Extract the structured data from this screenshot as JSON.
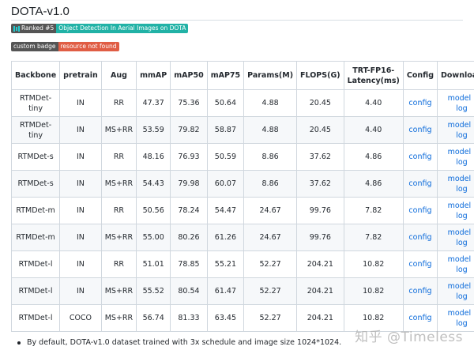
{
  "page": {
    "title": "DOTA-v1.0"
  },
  "badges": [
    {
      "left": "Ranked #5",
      "right": "Object Detection In Aerial Images on DOTA",
      "icon": "paperswithcode-icon"
    },
    {
      "left": "custom badge",
      "right": "resource not found"
    }
  ],
  "table": {
    "headers": [
      "Backbone",
      "pretrain",
      "Aug",
      "mmAP",
      "mAP50",
      "mAP75",
      "Params(M)",
      "FLOPS(G)",
      "TRT-FP16-Latency(ms)",
      "Config",
      "Download"
    ],
    "rows": [
      {
        "backbone": "RTMDet-tiny",
        "pretrain": "IN",
        "aug": "RR",
        "mmap": "47.37",
        "map50": "75.36",
        "map75": "50.64",
        "params": "4.88",
        "flops": "20.45",
        "latency": "4.40",
        "config": "config",
        "model": "model",
        "sep": "|",
        "log": "log"
      },
      {
        "backbone": "RTMDet-tiny",
        "pretrain": "IN",
        "aug": "MS+RR",
        "mmap": "53.59",
        "map50": "79.82",
        "map75": "58.87",
        "params": "4.88",
        "flops": "20.45",
        "latency": "4.40",
        "config": "config",
        "model": "model",
        "sep": "|",
        "log": "log"
      },
      {
        "backbone": "RTMDet-s",
        "pretrain": "IN",
        "aug": "RR",
        "mmap": "48.16",
        "map50": "76.93",
        "map75": "50.59",
        "params": "8.86",
        "flops": "37.62",
        "latency": "4.86",
        "config": "config",
        "model": "model",
        "sep": "|",
        "log": "log"
      },
      {
        "backbone": "RTMDet-s",
        "pretrain": "IN",
        "aug": "MS+RR",
        "mmap": "54.43",
        "map50": "79.98",
        "map75": "60.07",
        "params": "8.86",
        "flops": "37.62",
        "latency": "4.86",
        "config": "config",
        "model": "model",
        "sep": "|",
        "log": "log"
      },
      {
        "backbone": "RTMDet-m",
        "pretrain": "IN",
        "aug": "RR",
        "mmap": "50.56",
        "map50": "78.24",
        "map75": "54.47",
        "params": "24.67",
        "flops": "99.76",
        "latency": "7.82",
        "config": "config",
        "model": "model",
        "sep": "|",
        "log": "log"
      },
      {
        "backbone": "RTMDet-m",
        "pretrain": "IN",
        "aug": "MS+RR",
        "mmap": "55.00",
        "map50": "80.26",
        "map75": "61.26",
        "params": "24.67",
        "flops": "99.76",
        "latency": "7.82",
        "config": "config",
        "model": "model",
        "sep": "|",
        "log": "log"
      },
      {
        "backbone": "RTMDet-l",
        "pretrain": "IN",
        "aug": "RR",
        "mmap": "51.01",
        "map50": "78.85",
        "map75": "55.21",
        "params": "52.27",
        "flops": "204.21",
        "latency": "10.82",
        "config": "config",
        "model": "model",
        "sep": "|",
        "log": "log"
      },
      {
        "backbone": "RTMDet-l",
        "pretrain": "IN",
        "aug": "MS+RR",
        "mmap": "55.52",
        "map50": "80.54",
        "map75": "61.47",
        "params": "52.27",
        "flops": "204.21",
        "latency": "10.82",
        "config": "config",
        "model": "model",
        "sep": "|",
        "log": "log"
      },
      {
        "backbone": "RTMDet-l",
        "pretrain": "COCO",
        "aug": "MS+RR",
        "mmap": "56.74",
        "map50": "81.33",
        "map75": "63.45",
        "params": "52.27",
        "flops": "204.21",
        "latency": "10.82",
        "config": "config",
        "model": "model",
        "sep": "|",
        "log": "log"
      }
    ]
  },
  "notes": [
    "By default, DOTA-v1.0 dataset trained with 3x schedule and image size 1024*1024."
  ],
  "watermark": "知乎 @Timeless",
  "colors": {
    "link": "#0969da",
    "badge_teal": "#21b2a6",
    "badge_red": "#e05d44",
    "badge_gray": "#555555"
  }
}
